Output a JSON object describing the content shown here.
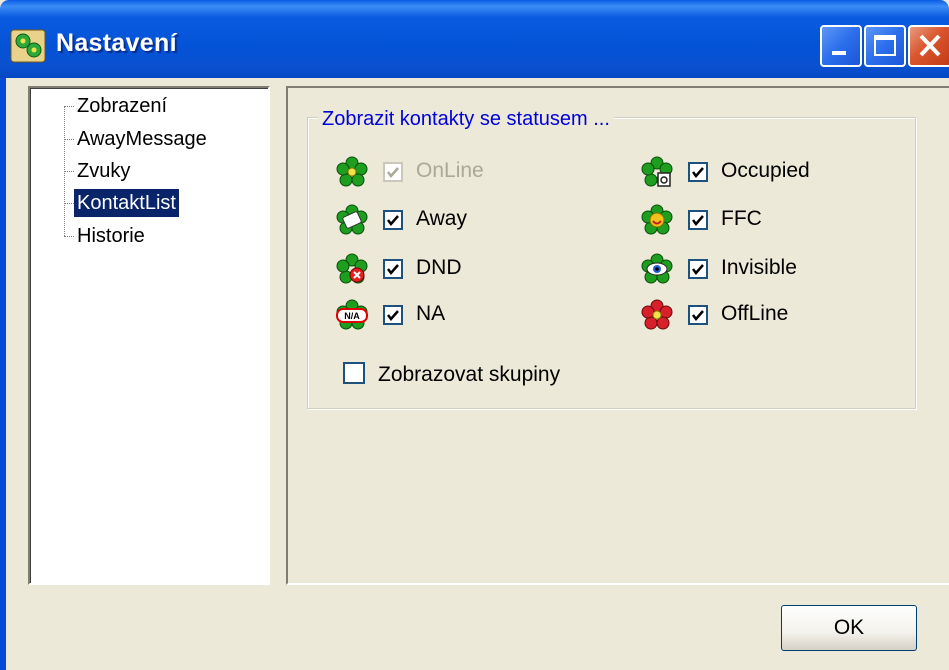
{
  "window": {
    "title": "Nastavení"
  },
  "titlebar_buttons": {
    "minimize": "minimize-icon",
    "maximize": "maximize-icon",
    "close": "close-icon"
  },
  "tree": {
    "items": [
      {
        "label": "Zobrazení",
        "selected": false
      },
      {
        "label": "AwayMessage",
        "selected": false
      },
      {
        "label": "Zvuky",
        "selected": false
      },
      {
        "label": "KontaktList",
        "selected": true
      },
      {
        "label": "Historie",
        "selected": false
      }
    ]
  },
  "group": {
    "legend": "Zobrazit kontakty se statusem ...",
    "statuses_left": [
      {
        "label": "OnLine",
        "checked": true,
        "enabled": false,
        "icon": "online-flower-icon"
      },
      {
        "label": "Away",
        "checked": true,
        "enabled": true,
        "icon": "away-icon"
      },
      {
        "label": "DND",
        "checked": true,
        "enabled": true,
        "icon": "dnd-icon"
      },
      {
        "label": "NA",
        "checked": true,
        "enabled": true,
        "icon": "na-icon"
      }
    ],
    "statuses_right": [
      {
        "label": "Occupied",
        "checked": true,
        "enabled": true,
        "icon": "occupied-icon"
      },
      {
        "label": "FFC",
        "checked": true,
        "enabled": true,
        "icon": "ffc-icon"
      },
      {
        "label": "Invisible",
        "checked": true,
        "enabled": true,
        "icon": "invisible-icon"
      },
      {
        "label": "OffLine",
        "checked": true,
        "enabled": true,
        "icon": "offline-flower-icon"
      }
    ],
    "show_groups_label": "Zobrazovat skupiny",
    "show_groups_checked": false
  },
  "buttons": {
    "ok_label": "OK"
  },
  "colors": {
    "titlebar": "#0453D7",
    "legend_text": "#0000DD",
    "selection": "#0A246A",
    "online_green": "#1E9E1E",
    "offline_red": "#D8202A"
  }
}
